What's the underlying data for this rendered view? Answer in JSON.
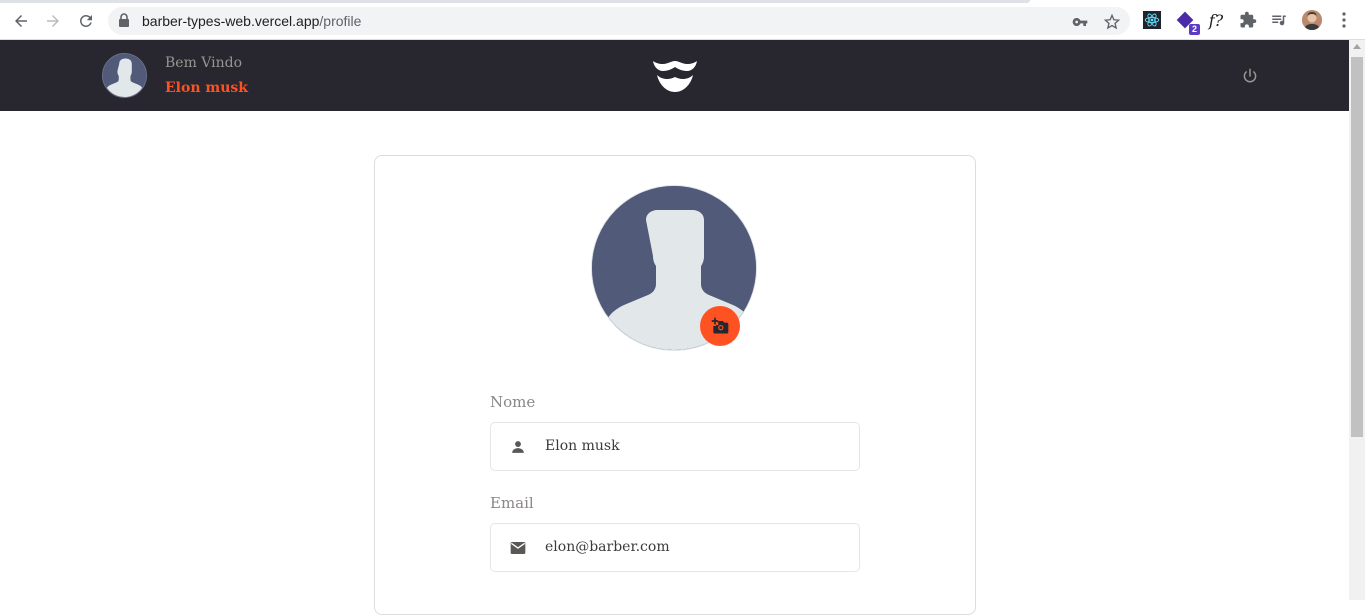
{
  "browser": {
    "url_host": "barber-types-web.vercel.app",
    "url_path": "/profile",
    "extensions": [
      "react-devtools-icon",
      "apollo-icon",
      "formula-icon",
      "puzzle-icon",
      "media-playlist-icon"
    ],
    "extension_badge": "2",
    "formula_label": "f?"
  },
  "header": {
    "welcome": "Bem Vindo",
    "user_name": "Elon musk"
  },
  "profile": {
    "name_label": "Nome",
    "name_value": "Elon musk",
    "email_label": "Email",
    "email_value": "elon@barber.com"
  },
  "colors": {
    "accent": "#ff5223",
    "header_bg": "#28262e",
    "avatar_bg": "#525a7a"
  }
}
